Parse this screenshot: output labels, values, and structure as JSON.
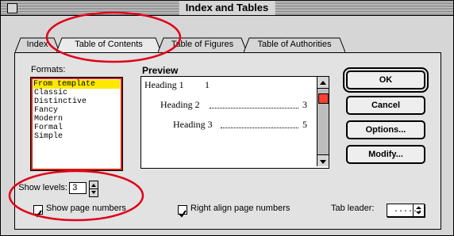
{
  "window": {
    "title": "Index and Tables"
  },
  "tabs": [
    {
      "label": "Index"
    },
    {
      "label": "Table of Contents"
    },
    {
      "label": "Table of Figures"
    },
    {
      "label": "Table of Authorities"
    }
  ],
  "formats": {
    "label": "Formats:",
    "items": [
      "From template",
      "Classic",
      "Distinctive",
      "Fancy",
      "Modern",
      "Formal",
      "Simple"
    ],
    "selected": "From template"
  },
  "preview": {
    "label": "Preview",
    "lines": [
      {
        "text": "Heading 1",
        "page": "1"
      },
      {
        "text": "Heading 2",
        "page": "3"
      },
      {
        "text": "Heading 3",
        "page": "5"
      }
    ]
  },
  "buttons": {
    "ok": "OK",
    "cancel": "Cancel",
    "options": "Options...",
    "modify": "Modify..."
  },
  "show_levels": {
    "label": "Show levels:",
    "value": "3"
  },
  "show_page_numbers": {
    "label": "Show page numbers",
    "checked": true
  },
  "right_align": {
    "label": "Right align page numbers",
    "checked": true
  },
  "tab_leader": {
    "label": "Tab leader:",
    "value": "......"
  },
  "colors": {
    "selection": "#ffe800",
    "annotation": "#e0001a",
    "list_border": "#cc2200"
  }
}
